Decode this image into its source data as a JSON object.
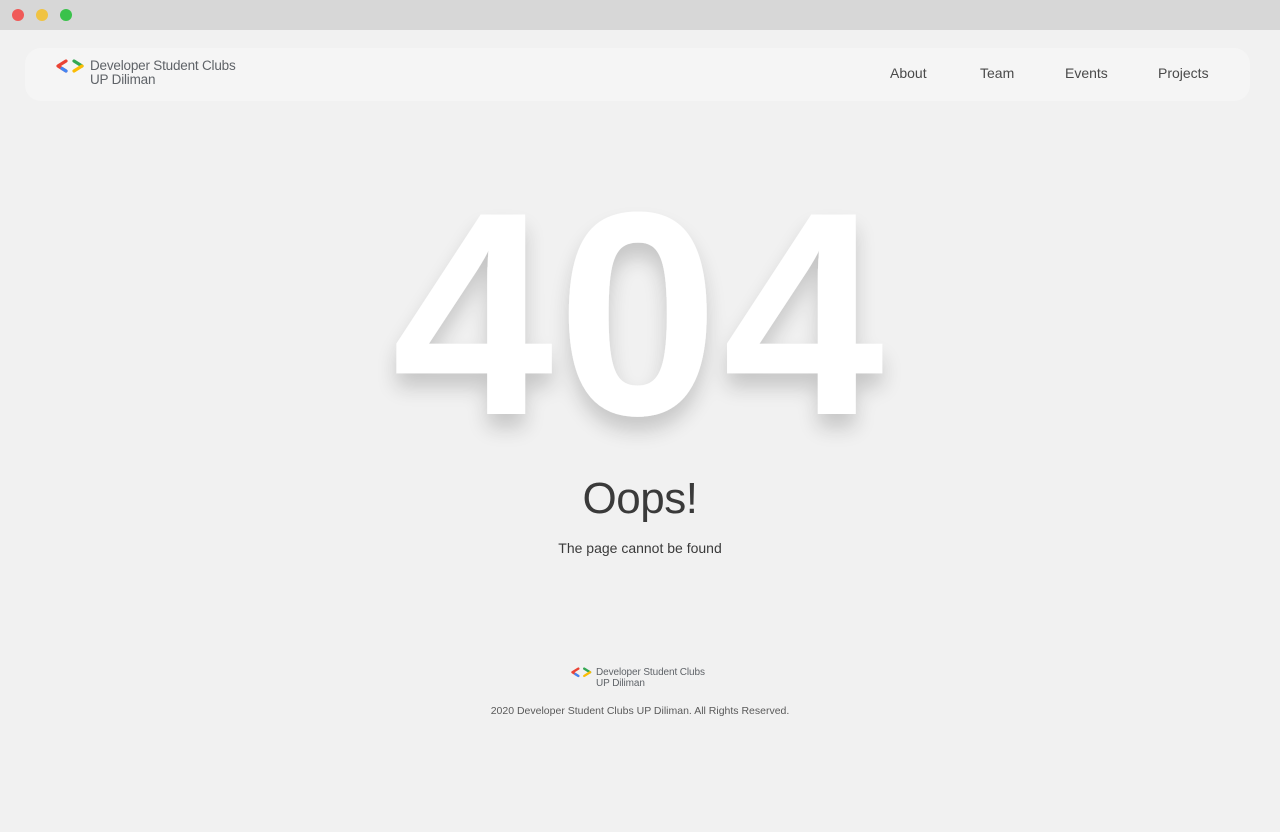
{
  "window": {
    "controls": [
      "close",
      "minimize",
      "maximize"
    ],
    "colors": {
      "close": "#f05a58",
      "minimize": "#f0c343",
      "maximize": "#3ac24b"
    }
  },
  "header": {
    "brand": {
      "line1": "Developer Student Clubs",
      "line2": "UP Diliman",
      "logo_icon": "gdsc-brackets-logo"
    },
    "nav": [
      {
        "label": "About"
      },
      {
        "label": "Team"
      },
      {
        "label": "Events"
      },
      {
        "label": "Projects"
      }
    ]
  },
  "main": {
    "code": "404",
    "headline": "Oops!",
    "message": "The page cannot be found"
  },
  "footer": {
    "brand": {
      "line1": "Developer Student Clubs",
      "line2": "UP Diliman"
    },
    "copyright": "2020 Developer Student Clubs UP Diliman. All Rights Reserved."
  },
  "colors": {
    "background": "#f1f1f1",
    "logo_blue": "#4285f4",
    "logo_red": "#ea4335",
    "logo_green": "#34a853",
    "logo_yellow": "#fbbc04"
  }
}
